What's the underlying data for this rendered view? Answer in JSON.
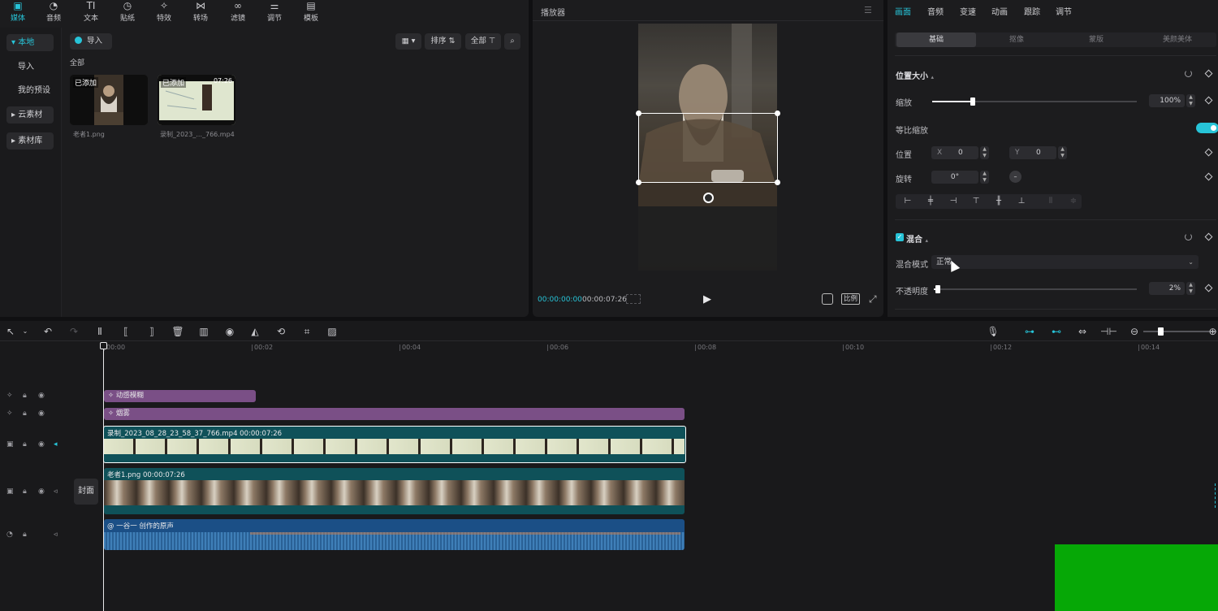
{
  "media_toolbar": {
    "items": [
      {
        "label": "媒体",
        "icon": "media-icon",
        "glyph": "▣"
      },
      {
        "label": "音频",
        "icon": "audio-icon",
        "glyph": "◔"
      },
      {
        "label": "文本",
        "icon": "text-icon",
        "glyph": "TI"
      },
      {
        "label": "贴纸",
        "icon": "sticker-icon",
        "glyph": "◷"
      },
      {
        "label": "特效",
        "icon": "effects-icon",
        "glyph": "✧"
      },
      {
        "label": "转场",
        "icon": "transition-icon",
        "glyph": "⋈"
      },
      {
        "label": "滤镜",
        "icon": "filter-icon",
        "glyph": "∞"
      },
      {
        "label": "调节",
        "icon": "adjust-icon",
        "glyph": "⚌"
      },
      {
        "label": "模板",
        "icon": "template-icon",
        "glyph": "▤"
      }
    ]
  },
  "media_sidebar": {
    "items": [
      {
        "label": "▾ 本地"
      },
      {
        "label": "导入"
      },
      {
        "label": "我的预设"
      },
      {
        "label": "▸ 云素材"
      },
      {
        "label": "▸ 素材库"
      }
    ]
  },
  "media_panel": {
    "import_label": "导入",
    "sort_label": "排序",
    "filter_label": "全部",
    "section_label": "全部",
    "assets": [
      {
        "badge": "已添加",
        "name": "老者1.png"
      },
      {
        "badge": "已添加",
        "duration": "07:26",
        "name": "录制_2023_..._766.mp4"
      }
    ]
  },
  "player": {
    "title": "播放器",
    "current_time": "00:00:00:00",
    "total_time": "00:00:07:26",
    "ratio_label": "比例"
  },
  "inspector": {
    "tabs": [
      "画面",
      "音频",
      "变速",
      "动画",
      "跟踪",
      "调节"
    ],
    "subtabs": [
      "基础",
      "抠像",
      "蒙版",
      "美颜美体"
    ],
    "position_size": {
      "title": "位置大小",
      "scale_label": "缩放",
      "scale_value": "100%",
      "scale_fraction": 0.2,
      "uniform_scale_label": "等比缩放",
      "position_label": "位置",
      "x_label": "X",
      "x_value": "0",
      "y_label": "Y",
      "y_value": "0",
      "rotate_label": "旋转",
      "rotate_value": "0°"
    },
    "blend": {
      "title": "混合",
      "mode_label": "混合模式",
      "mode_value": "正常",
      "opacity_label": "不透明度",
      "opacity_value": "2%",
      "opacity_fraction": 0.02
    }
  },
  "timeline": {
    "ticks": [
      "00:00",
      "00:02",
      "00:04",
      "00:06",
      "00:08",
      "00:10",
      "00:12",
      "00:14"
    ],
    "cover_label": "封面",
    "clips": {
      "fx1": "动感模糊",
      "fx2": "烟雾",
      "video_main": "录制_2023_08_28_23_58_37_766.mp4   00:00:07:26",
      "video_image": "老者1.png   00:00:07:26",
      "audio": "@ 一谷一 创作的原声"
    }
  },
  "colors": {
    "accent": "#27c4d8",
    "fx_clip": "#7a4f86",
    "video_track": "#0f5159",
    "audio_track": "#1b4f86",
    "green_overlay": "#06a806"
  }
}
